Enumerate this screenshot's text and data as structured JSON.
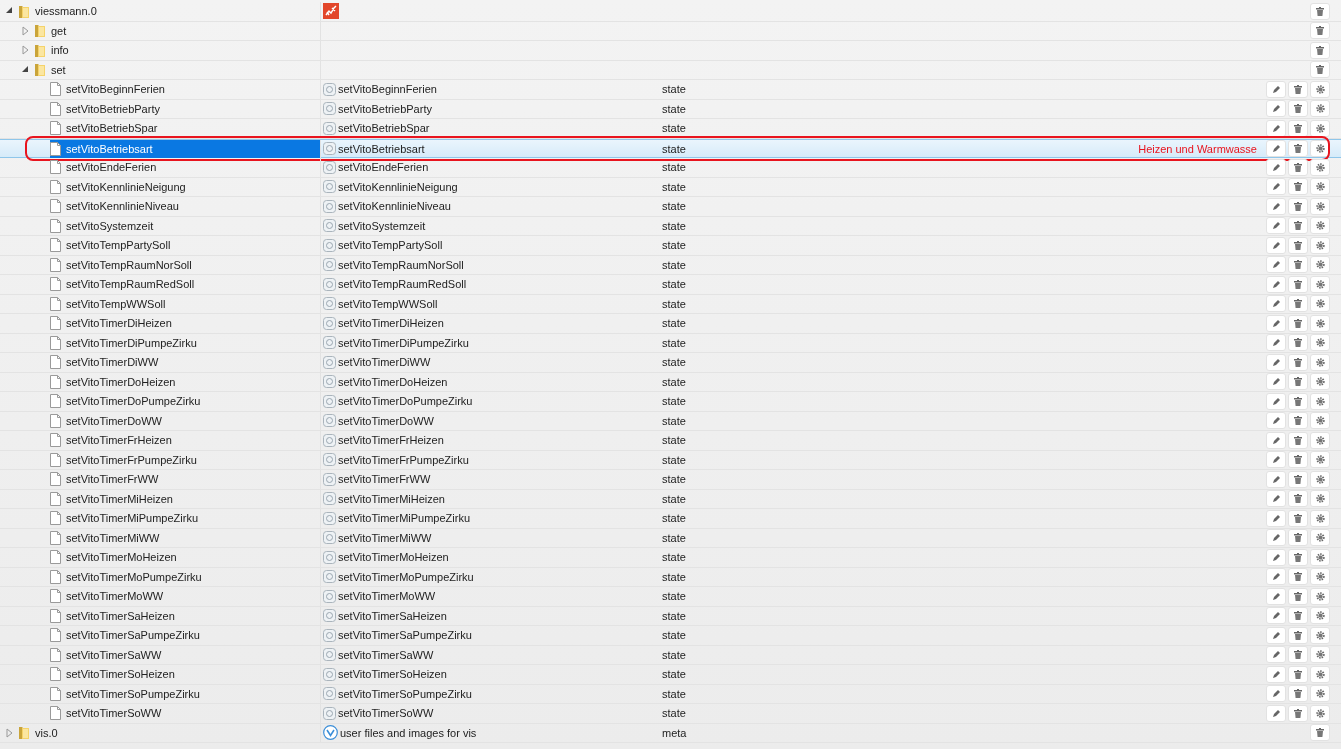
{
  "tree": [
    {
      "kind": "adapter",
      "name": "viessmann.0",
      "expanded": true,
      "selected": false,
      "children": [
        {
          "kind": "folder",
          "name": "get",
          "expanded": false,
          "selected": false
        },
        {
          "kind": "folder",
          "name": "info",
          "expanded": false,
          "selected": false
        },
        {
          "kind": "folder",
          "name": "set",
          "expanded": true,
          "selected": false,
          "children": [
            {
              "kind": "state",
              "name": "setVitoBeginnFerien",
              "title": "setVitoBeginnFerien",
              "type": "state",
              "selected": false
            },
            {
              "kind": "state",
              "name": "setVitoBetriebParty",
              "title": "setVitoBetriebParty",
              "type": "state",
              "selected": false
            },
            {
              "kind": "state",
              "name": "setVitoBetriebSpar",
              "title": "setVitoBetriebSpar",
              "type": "state",
              "selected": false
            },
            {
              "kind": "state",
              "name": "setVitoBetriebsart",
              "title": "setVitoBetriebsart",
              "type": "state",
              "value": "Heizen und Warmwasse",
              "selected": true
            },
            {
              "kind": "state",
              "name": "setVitoEndeFerien",
              "title": "setVitoEndeFerien",
              "type": "state",
              "selected": false
            },
            {
              "kind": "state",
              "name": "setVitoKennlinieNeigung",
              "title": "setVitoKennlinieNeigung",
              "type": "state",
              "selected": false
            },
            {
              "kind": "state",
              "name": "setVitoKennlinieNiveau",
              "title": "setVitoKennlinieNiveau",
              "type": "state",
              "selected": false
            },
            {
              "kind": "state",
              "name": "setVitoSystemzeit",
              "title": "setVitoSystemzeit",
              "type": "state",
              "selected": false
            },
            {
              "kind": "state",
              "name": "setVitoTempPartySoll",
              "title": "setVitoTempPartySoll",
              "type": "state",
              "selected": false
            },
            {
              "kind": "state",
              "name": "setVitoTempRaumNorSoll",
              "title": "setVitoTempRaumNorSoll",
              "type": "state",
              "selected": false
            },
            {
              "kind": "state",
              "name": "setVitoTempRaumRedSoll",
              "title": "setVitoTempRaumRedSoll",
              "type": "state",
              "selected": false
            },
            {
              "kind": "state",
              "name": "setVitoTempWWSoll",
              "title": "setVitoTempWWSoll",
              "type": "state",
              "selected": false
            },
            {
              "kind": "state",
              "name": "setVitoTimerDiHeizen",
              "title": "setVitoTimerDiHeizen",
              "type": "state",
              "selected": false
            },
            {
              "kind": "state",
              "name": "setVitoTimerDiPumpeZirku",
              "title": "setVitoTimerDiPumpeZirku",
              "type": "state",
              "selected": false
            },
            {
              "kind": "state",
              "name": "setVitoTimerDiWW",
              "title": "setVitoTimerDiWW",
              "type": "state",
              "selected": false
            },
            {
              "kind": "state",
              "name": "setVitoTimerDoHeizen",
              "title": "setVitoTimerDoHeizen",
              "type": "state",
              "selected": false
            },
            {
              "kind": "state",
              "name": "setVitoTimerDoPumpeZirku",
              "title": "setVitoTimerDoPumpeZirku",
              "type": "state",
              "selected": false
            },
            {
              "kind": "state",
              "name": "setVitoTimerDoWW",
              "title": "setVitoTimerDoWW",
              "type": "state",
              "selected": false
            },
            {
              "kind": "state",
              "name": "setVitoTimerFrHeizen",
              "title": "setVitoTimerFrHeizen",
              "type": "state",
              "selected": false
            },
            {
              "kind": "state",
              "name": "setVitoTimerFrPumpeZirku",
              "title": "setVitoTimerFrPumpeZirku",
              "type": "state",
              "selected": false
            },
            {
              "kind": "state",
              "name": "setVitoTimerFrWW",
              "title": "setVitoTimerFrWW",
              "type": "state",
              "selected": false
            },
            {
              "kind": "state",
              "name": "setVitoTimerMiHeizen",
              "title": "setVitoTimerMiHeizen",
              "type": "state",
              "selected": false
            },
            {
              "kind": "state",
              "name": "setVitoTimerMiPumpeZirku",
              "title": "setVitoTimerMiPumpeZirku",
              "type": "state",
              "selected": false
            },
            {
              "kind": "state",
              "name": "setVitoTimerMiWW",
              "title": "setVitoTimerMiWW",
              "type": "state",
              "selected": false
            },
            {
              "kind": "state",
              "name": "setVitoTimerMoHeizen",
              "title": "setVitoTimerMoHeizen",
              "type": "state",
              "selected": false
            },
            {
              "kind": "state",
              "name": "setVitoTimerMoPumpeZirku",
              "title": "setVitoTimerMoPumpeZirku",
              "type": "state",
              "selected": false
            },
            {
              "kind": "state",
              "name": "setVitoTimerMoWW",
              "title": "setVitoTimerMoWW",
              "type": "state",
              "selected": false
            },
            {
              "kind": "state",
              "name": "setVitoTimerSaHeizen",
              "title": "setVitoTimerSaHeizen",
              "type": "state",
              "selected": false
            },
            {
              "kind": "state",
              "name": "setVitoTimerSaPumpeZirku",
              "title": "setVitoTimerSaPumpeZirku",
              "type": "state",
              "selected": false
            },
            {
              "kind": "state",
              "name": "setVitoTimerSaWW",
              "title": "setVitoTimerSaWW",
              "type": "state",
              "selected": false
            },
            {
              "kind": "state",
              "name": "setVitoTimerSoHeizen",
              "title": "setVitoTimerSoHeizen",
              "type": "state",
              "selected": false
            },
            {
              "kind": "state",
              "name": "setVitoTimerSoPumpeZirku",
              "title": "setVitoTimerSoPumpeZirku",
              "type": "state",
              "selected": false
            },
            {
              "kind": "state",
              "name": "setVitoTimerSoWW",
              "title": "setVitoTimerSoWW",
              "type": "state",
              "selected": false
            }
          ]
        }
      ]
    },
    {
      "kind": "adapter",
      "name": "vis.0",
      "title": "user files and images for vis",
      "type": "meta",
      "expanded": false,
      "selected": false
    }
  ]
}
